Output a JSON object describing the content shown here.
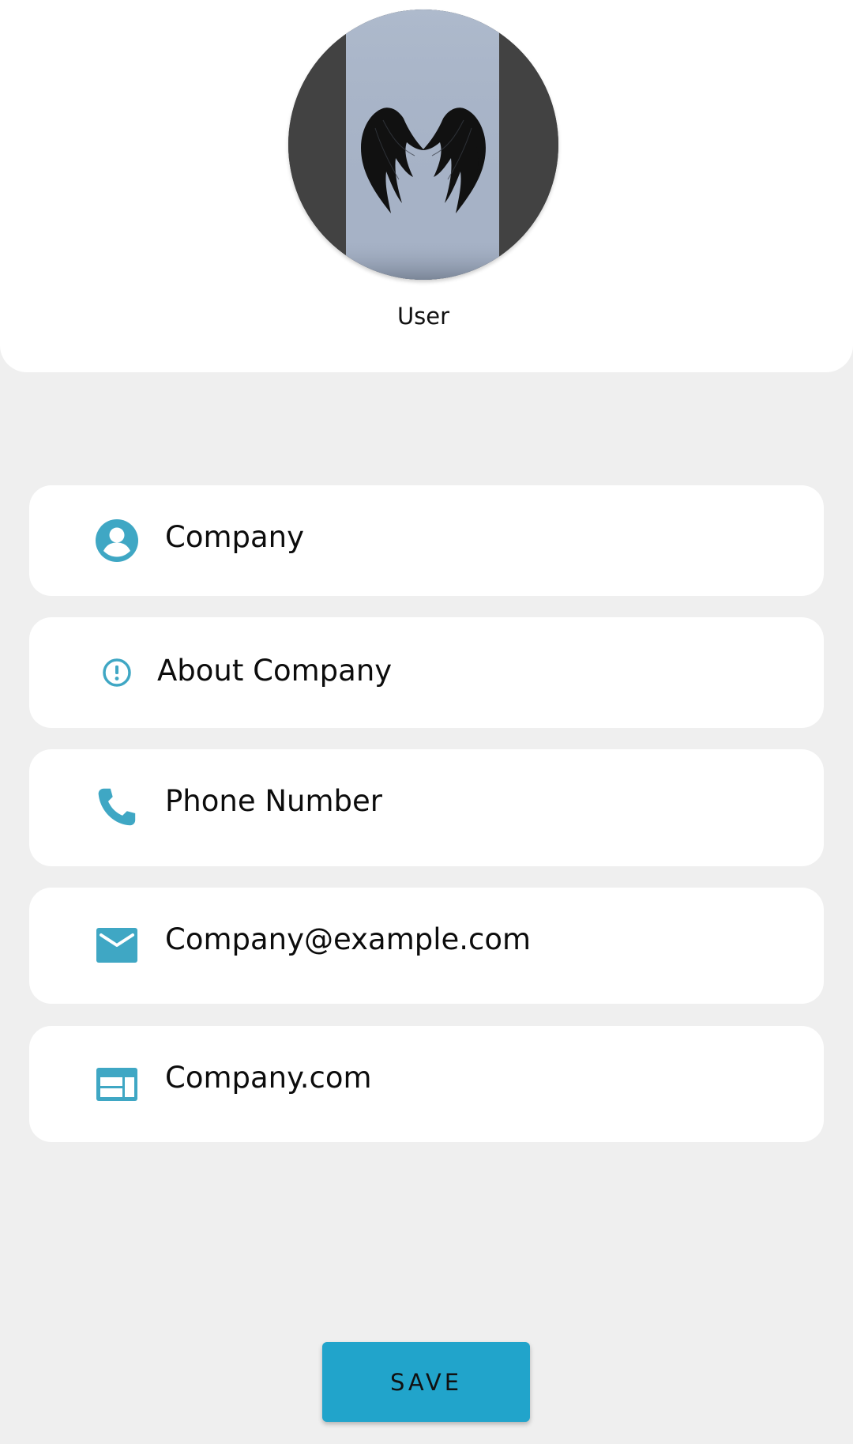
{
  "profile": {
    "name": "User",
    "avatar_description": "angel-wings-wallpaper",
    "avatar_bg": "#424242",
    "avatar_panel": "#a6b2c6"
  },
  "fields": {
    "company_name": {
      "value": "Company",
      "icon": "account-circle-icon"
    },
    "about": {
      "value": "About Company",
      "icon": "info-outline-icon"
    },
    "phone": {
      "value": "Phone Number",
      "icon": "phone-icon"
    },
    "email": {
      "value": "Company@example.com",
      "icon": "email-icon"
    },
    "website": {
      "value": "Company.com",
      "icon": "web-icon"
    }
  },
  "actions": {
    "save_label": "SAVE"
  },
  "colors": {
    "accent": "#21a4cb",
    "icon": "#3fa7c4",
    "background": "#efefef",
    "card": "#ffffff"
  }
}
